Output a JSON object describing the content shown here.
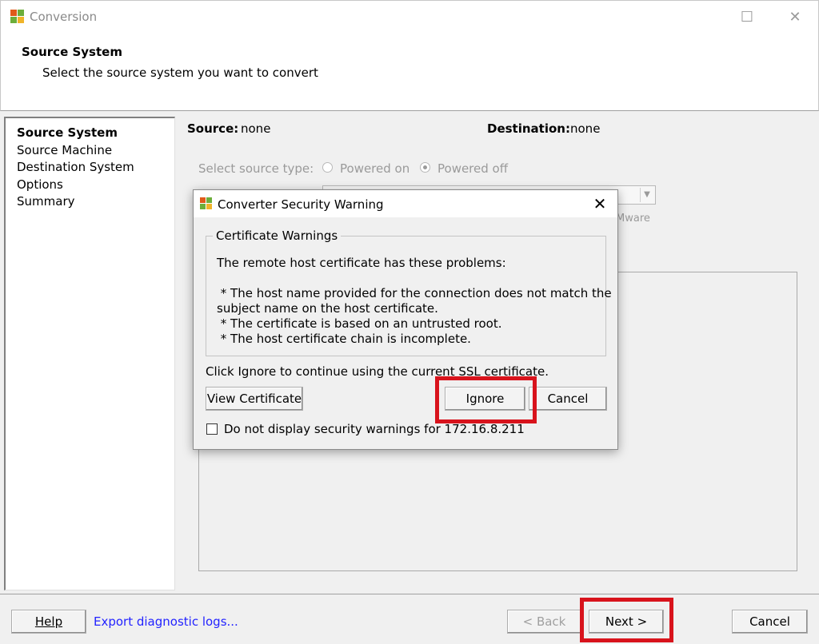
{
  "window": {
    "title": "Conversion",
    "minimize_glyph": "—",
    "maximize_glyph": "☐",
    "close_glyph": "✕"
  },
  "header": {
    "title": "Source System",
    "subtitle": "Select the source system you want to convert"
  },
  "nav": {
    "items": [
      {
        "label": "Source System",
        "active": true
      },
      {
        "label": "Source Machine",
        "active": false
      },
      {
        "label": "Destination System",
        "active": false
      },
      {
        "label": "Options",
        "active": false
      },
      {
        "label": "Summary",
        "active": false
      }
    ]
  },
  "content": {
    "source_label": "Source:",
    "source_value": "none",
    "destination_label": "Destination:",
    "destination_value": "none",
    "source_type_label": "Select source type:",
    "radio_powered_on": "Powered on",
    "radio_powered_off": "Powered off",
    "selected_source_type": "Powered off",
    "partial_text": "Mware"
  },
  "dialog": {
    "title": "Converter Security Warning",
    "close_glyph": "✕",
    "group_title": "Certificate Warnings",
    "lines": [
      "The remote host certificate has these problems:",
      " * The host name provided for the connection does not match the",
      "subject name on the host certificate.",
      " * The certificate is based on an untrusted root.",
      " * The host certificate chain is incomplete."
    ],
    "note": "Click Ignore to continue using the current SSL certificate.",
    "view_certificate": "View Certificate",
    "ignore": "Ignore",
    "cancel": "Cancel",
    "checkbox_label": "Do not display security warnings for 172.16.8.211",
    "checkbox_checked": false
  },
  "footer": {
    "help": "Help",
    "export_logs": "Export diagnostic logs...",
    "back": "< Back",
    "next": "Next >",
    "cancel": "Cancel"
  },
  "colors": {
    "highlight": "#d8131c",
    "link": "#2323ff"
  }
}
